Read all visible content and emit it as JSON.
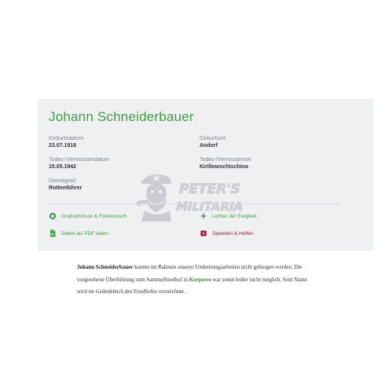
{
  "person": {
    "name": "Johann Schneiderbauer",
    "birth_date_label": "Geburtsdatum",
    "birth_date": "23.07.1918",
    "birth_place_label": "Geburtsort",
    "birth_place": "Andorf",
    "death_date_label": "Todes-/Vermisstendatum",
    "death_date": "10.05.1942",
    "death_place_label": "Todes-/Vermisstenort",
    "death_place": "Kirillowschtschina",
    "rank_label": "Dienstgrad",
    "rank": "Rottenführer"
  },
  "actions": {
    "grave_jewelry": "Grabschmuck & Fotowunsch",
    "eternal_lights": "Lichter der Ewigkeit",
    "pdf_download": "Daten als PDF laden",
    "donate": "Spenden & Helfen"
  },
  "watermark": {
    "line1": "PETER'S",
    "line2": "MILITARIA"
  },
  "bio": {
    "name": "Johann Schneiderbauer",
    "text1": " konnte im Rahmen unserer Umbettungsarbeiten nicht geborgen werden. Die vorgesehene Überführung zum Sammelfriedhof in ",
    "place": "Korpowo",
    "text2": " war somit leider nicht möglich. Sein Name wird im Gedenkbuch des Friedhofes verzeichnet."
  },
  "colors": {
    "accent_green": "#43a047",
    "accent_red": "#b0173a",
    "card_bg": "#eef0f2"
  },
  "icons": [
    "flower-badge-icon",
    "candle-sparkle-icon",
    "pdf-file-icon",
    "heart-flower-icon"
  ]
}
